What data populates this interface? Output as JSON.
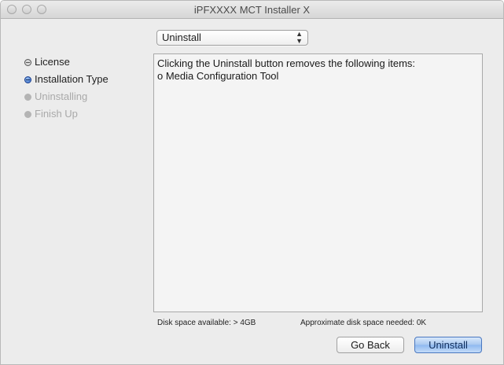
{
  "window": {
    "title": "iPFXXXX MCT Installer X"
  },
  "steps": [
    {
      "label": "License",
      "state": "done"
    },
    {
      "label": "Installation Type",
      "state": "current"
    },
    {
      "label": "Uninstalling",
      "state": "pending"
    },
    {
      "label": "Finish Up",
      "state": "pending"
    }
  ],
  "install_type": {
    "selected": "Uninstall"
  },
  "panel": {
    "line1": "Clicking the Uninstall button removes the following items:",
    "line2": "o Media Configuration Tool"
  },
  "disk": {
    "available": "Disk space available: > 4GB",
    "needed": "Approximate disk space needed: 0K"
  },
  "buttons": {
    "back": "Go Back",
    "primary": "Uninstall"
  },
  "colors": {
    "accent": "#2a62c6",
    "window_bg": "#ececec",
    "panel_bg": "#f4f4f4"
  }
}
